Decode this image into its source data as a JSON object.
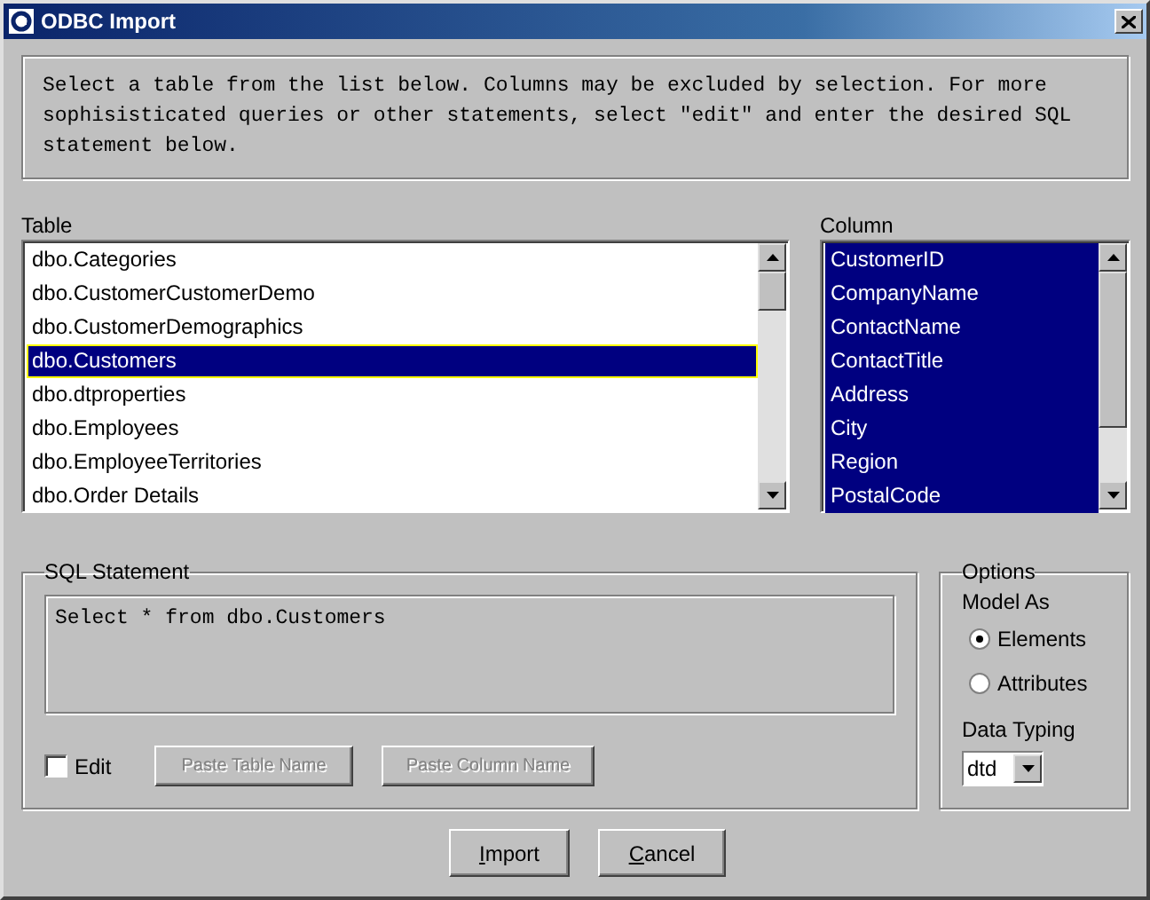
{
  "window": {
    "title": "ODBC Import"
  },
  "instructions": "Select a table from the list below. Columns may be excluded by selection. For more sophisisticated queries or other statements, select \"edit\" and enter the desired SQL statement below.",
  "table_list": {
    "label": "Table",
    "items": [
      {
        "label": "dbo.Categories",
        "selected": false
      },
      {
        "label": "dbo.CustomerCustomerDemo",
        "selected": false
      },
      {
        "label": "dbo.CustomerDemographics",
        "selected": false
      },
      {
        "label": "dbo.Customers",
        "selected": true
      },
      {
        "label": "dbo.dtproperties",
        "selected": false
      },
      {
        "label": "dbo.Employees",
        "selected": false
      },
      {
        "label": "dbo.EmployeeTerritories",
        "selected": false
      },
      {
        "label": "dbo.Order Details",
        "selected": false
      }
    ]
  },
  "column_list": {
    "label": "Column",
    "items": [
      {
        "label": "CustomerID",
        "selected": true
      },
      {
        "label": "CompanyName",
        "selected": true
      },
      {
        "label": "ContactName",
        "selected": true
      },
      {
        "label": "ContactTitle",
        "selected": true
      },
      {
        "label": "Address",
        "selected": true
      },
      {
        "label": "City",
        "selected": true
      },
      {
        "label": "Region",
        "selected": true
      },
      {
        "label": "PostalCode",
        "selected": true
      }
    ]
  },
  "sql_group": {
    "title": "SQL Statement",
    "statement": "Select * from dbo.Customers",
    "edit": {
      "label": "Edit",
      "checked": false
    },
    "buttons": [
      {
        "label": "Paste Table Name",
        "disabled": true
      },
      {
        "label": "Paste Column Name",
        "disabled": true
      }
    ]
  },
  "options": {
    "title": "Options",
    "model_as": {
      "label": "Model As",
      "options": [
        {
          "label": "Elements",
          "selected": true
        },
        {
          "label": "Attributes",
          "selected": false
        }
      ]
    },
    "data_typing": {
      "label": "Data Typing",
      "value": "dtd"
    }
  },
  "buttons": [
    {
      "label": "Import",
      "disabled": false
    },
    {
      "label": "Cancel",
      "disabled": false
    }
  ]
}
